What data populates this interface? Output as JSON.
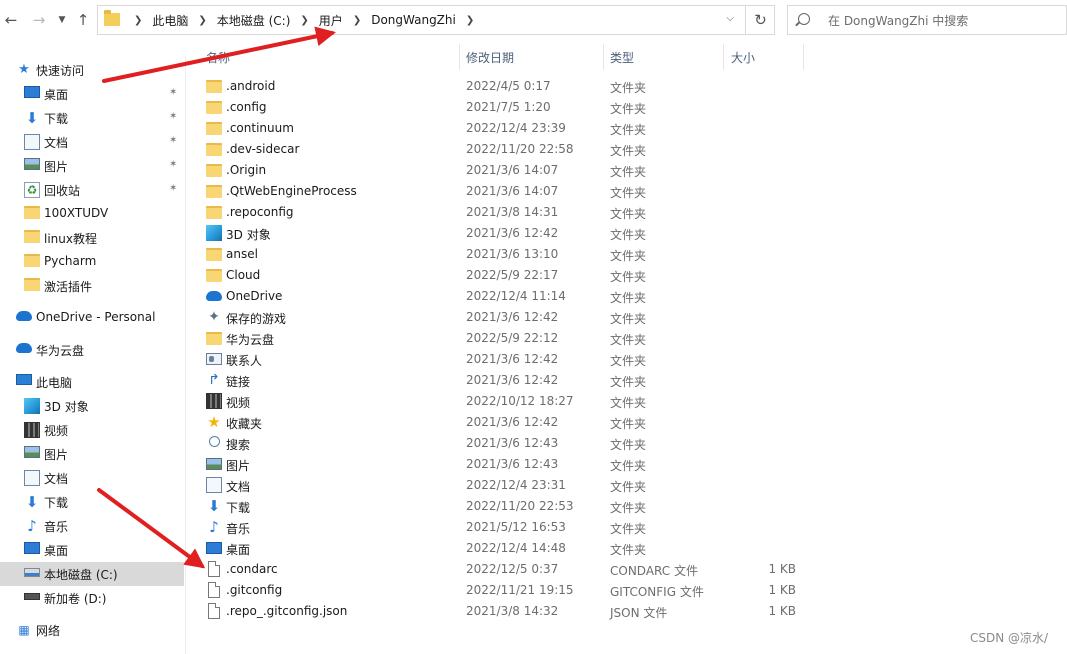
{
  "address_bar": {
    "crumbs": [
      "此电脑",
      "本地磁盘 (C:)",
      "用户",
      "DongWangZhi"
    ],
    "search_placeholder": "在 DongWangZhi 中搜索"
  },
  "columns": {
    "name": "名称",
    "date": "修改日期",
    "type": "类型",
    "size": "大小"
  },
  "sidebar": {
    "quick_access": "快速访问",
    "pinned": [
      {
        "label": "桌面",
        "icon": "desktop-icon"
      },
      {
        "label": "下载",
        "icon": "download-icon"
      },
      {
        "label": "文档",
        "icon": "documents-icon"
      },
      {
        "label": "图片",
        "icon": "pictures-icon"
      },
      {
        "label": "回收站",
        "icon": "recycle-bin-icon"
      }
    ],
    "recent": [
      {
        "label": "100XTUDV",
        "icon": "folder-icon"
      },
      {
        "label": "linux教程",
        "icon": "folder-icon"
      },
      {
        "label": "Pycharm",
        "icon": "folder-icon"
      },
      {
        "label": "激活插件",
        "icon": "folder-icon"
      }
    ],
    "onedrive": "OneDrive - Personal",
    "huawei": "华为云盘",
    "this_pc": "此电脑",
    "pc_items": [
      {
        "label": "3D 对象",
        "icon": "3d-objects-icon"
      },
      {
        "label": "视频",
        "icon": "videos-icon"
      },
      {
        "label": "图片",
        "icon": "pictures-icon"
      },
      {
        "label": "文档",
        "icon": "documents-icon"
      },
      {
        "label": "下载",
        "icon": "download-icon"
      },
      {
        "label": "音乐",
        "icon": "music-icon"
      },
      {
        "label": "桌面",
        "icon": "desktop-icon"
      },
      {
        "label": "本地磁盘 (C:)",
        "icon": "drive-c-icon"
      },
      {
        "label": "新加卷 (D:)",
        "icon": "drive-d-icon"
      }
    ],
    "network": "网络"
  },
  "files": [
    {
      "name": ".android",
      "date": "2022/4/5 0:17",
      "type": "文件夹",
      "size": "",
      "icon": "folder-icon"
    },
    {
      "name": ".config",
      "date": "2021/7/5 1:20",
      "type": "文件夹",
      "size": "",
      "icon": "folder-icon"
    },
    {
      "name": ".continuum",
      "date": "2022/12/4 23:39",
      "type": "文件夹",
      "size": "",
      "icon": "folder-icon"
    },
    {
      "name": ".dev-sidecar",
      "date": "2022/11/20 22:58",
      "type": "文件夹",
      "size": "",
      "icon": "folder-icon"
    },
    {
      "name": ".Origin",
      "date": "2021/3/6 14:07",
      "type": "文件夹",
      "size": "",
      "icon": "folder-icon"
    },
    {
      "name": ".QtWebEngineProcess",
      "date": "2021/3/6 14:07",
      "type": "文件夹",
      "size": "",
      "icon": "folder-icon"
    },
    {
      "name": ".repoconfig",
      "date": "2021/3/8 14:31",
      "type": "文件夹",
      "size": "",
      "icon": "folder-icon"
    },
    {
      "name": "3D 对象",
      "date": "2021/3/6 12:42",
      "type": "文件夹",
      "size": "",
      "icon": "3d-objects-icon"
    },
    {
      "name": "ansel",
      "date": "2021/3/6 13:10",
      "type": "文件夹",
      "size": "",
      "icon": "folder-icon"
    },
    {
      "name": "Cloud",
      "date": "2022/5/9 22:17",
      "type": "文件夹",
      "size": "",
      "icon": "folder-icon"
    },
    {
      "name": "OneDrive",
      "date": "2022/12/4 11:14",
      "type": "文件夹",
      "size": "",
      "icon": "onedrive-icon"
    },
    {
      "name": "保存的游戏",
      "date": "2021/3/6 12:42",
      "type": "文件夹",
      "size": "",
      "icon": "saved-games-icon"
    },
    {
      "name": "华为云盘",
      "date": "2022/5/9 22:12",
      "type": "文件夹",
      "size": "",
      "icon": "folder-icon"
    },
    {
      "name": "联系人",
      "date": "2021/3/6 12:42",
      "type": "文件夹",
      "size": "",
      "icon": "contacts-icon"
    },
    {
      "name": "链接",
      "date": "2021/3/6 12:42",
      "type": "文件夹",
      "size": "",
      "icon": "links-icon"
    },
    {
      "name": "视频",
      "date": "2022/10/12 18:27",
      "type": "文件夹",
      "size": "",
      "icon": "videos-icon"
    },
    {
      "name": "收藏夹",
      "date": "2021/3/6 12:42",
      "type": "文件夹",
      "size": "",
      "icon": "favorites-icon"
    },
    {
      "name": "搜索",
      "date": "2021/3/6 12:43",
      "type": "文件夹",
      "size": "",
      "icon": "searches-icon"
    },
    {
      "name": "图片",
      "date": "2021/3/6 12:43",
      "type": "文件夹",
      "size": "",
      "icon": "pictures-icon"
    },
    {
      "name": "文档",
      "date": "2022/12/4 23:31",
      "type": "文件夹",
      "size": "",
      "icon": "documents-icon"
    },
    {
      "name": "下载",
      "date": "2022/11/20 22:53",
      "type": "文件夹",
      "size": "",
      "icon": "download-icon"
    },
    {
      "name": "音乐",
      "date": "2021/5/12 16:53",
      "type": "文件夹",
      "size": "",
      "icon": "music-icon"
    },
    {
      "name": "桌面",
      "date": "2022/12/4 14:48",
      "type": "文件夹",
      "size": "",
      "icon": "desktop-icon"
    },
    {
      "name": ".condarc",
      "date": "2022/12/5 0:37",
      "type": "CONDARC 文件",
      "size": "1 KB",
      "icon": "file-icon"
    },
    {
      "name": ".gitconfig",
      "date": "2022/11/21 19:15",
      "type": "GITCONFIG 文件",
      "size": "1 KB",
      "icon": "file-icon"
    },
    {
      "name": ".repo_.gitconfig.json",
      "date": "2021/3/8 14:32",
      "type": "JSON 文件",
      "size": "1 KB",
      "icon": "file-icon"
    }
  ],
  "watermark": "CSDN @凉水/",
  "annotation_color": "#e02020"
}
